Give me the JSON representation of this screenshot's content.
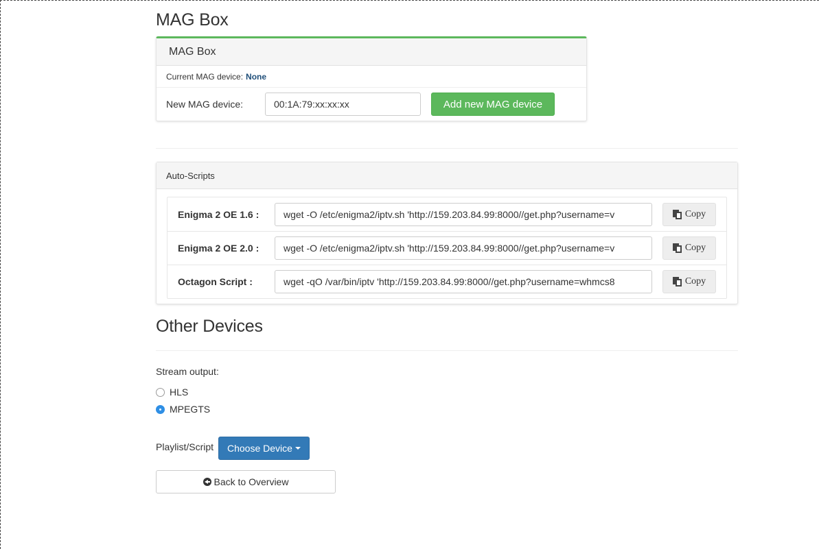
{
  "mag": {
    "page_title": "MAG Box",
    "panel_title": "MAG Box",
    "current_label": "Current MAG device:",
    "current_value": "None",
    "new_label": "New MAG device:",
    "new_placeholder": "00:1A:79:xx:xx:xx",
    "add_button": "Add new MAG device"
  },
  "auto_scripts": {
    "title": "Auto-Scripts",
    "copy_label": "Copy",
    "rows": [
      {
        "label": "Enigma 2 OE 1.6 :",
        "value": "wget -O /etc/enigma2/iptv.sh 'http://159.203.84.99:8000//get.php?username=v"
      },
      {
        "label": "Enigma 2 OE 2.0 :",
        "value": "wget -O /etc/enigma2/iptv.sh 'http://159.203.84.99:8000//get.php?username=v"
      },
      {
        "label": "Octagon Script :",
        "value": "wget -qO /var/bin/iptv 'http://159.203.84.99:8000//get.php?username=whmcs8"
      }
    ]
  },
  "other": {
    "title": "Other Devices",
    "stream_label": "Stream output:",
    "options": [
      {
        "label": "HLS",
        "selected": false
      },
      {
        "label": "MPEGTS",
        "selected": true
      }
    ],
    "playlist_label": "Playlist/Script",
    "choose_device": "Choose Device",
    "back_button": "Back to Overview"
  },
  "colors": {
    "success": "#5cb85c",
    "primary": "#337ab7",
    "link": "#1f4e79"
  }
}
